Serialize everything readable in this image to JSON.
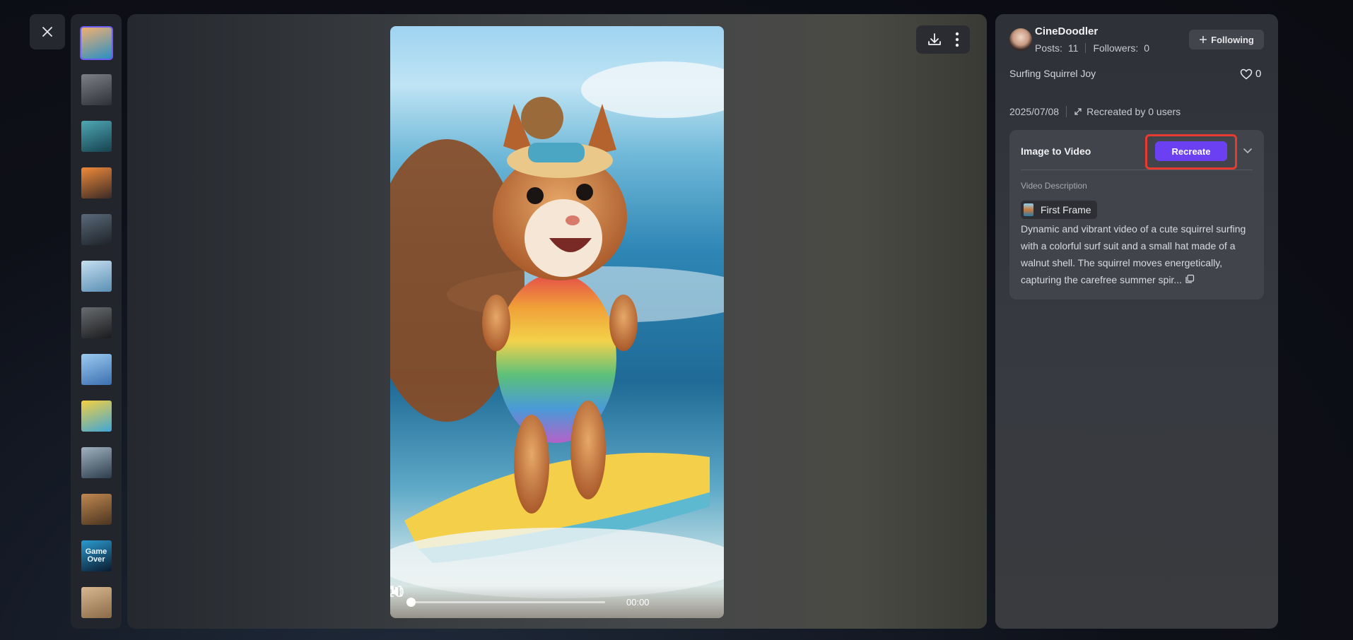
{
  "thumbnails": [
    {
      "label": "squirrel-surfing",
      "colors": [
        "#f0b070",
        "#2b8fc4"
      ]
    },
    {
      "label": "dark-battle",
      "colors": [
        "#7d8186",
        "#2d3035"
      ]
    },
    {
      "label": "underwater-creature",
      "colors": [
        "#4fa7b4",
        "#16424e"
      ]
    },
    {
      "label": "fire-dragon",
      "colors": [
        "#f08a3a",
        "#3a2a26"
      ]
    },
    {
      "label": "dark-figure",
      "colors": [
        "#5a6a7a",
        "#1d2228"
      ]
    },
    {
      "label": "ice-animal",
      "colors": [
        "#c6dff0",
        "#5a8fb4"
      ]
    },
    {
      "label": "armored-figure",
      "colors": [
        "#6a6d70",
        "#1a1b1d"
      ]
    },
    {
      "label": "blue-spirit",
      "colors": [
        "#9ccbf0",
        "#3b6fb0"
      ]
    },
    {
      "label": "yellow-float",
      "colors": [
        "#f5d042",
        "#3fa6d6"
      ]
    },
    {
      "label": "office-cat",
      "colors": [
        "#a0b2c0",
        "#2d3d4c"
      ]
    },
    {
      "label": "warm-scene",
      "colors": [
        "#c08850",
        "#4a3420"
      ]
    },
    {
      "label": "game-over",
      "colors": [
        "#2a9bd0",
        "#0a1a2e"
      ],
      "text": "Game Over"
    },
    {
      "label": "kitten",
      "colors": [
        "#d8b890",
        "#8a6a48"
      ]
    }
  ],
  "player": {
    "time": "00:00",
    "progress": 0.0
  },
  "author": {
    "name": "CineDoodler",
    "posts_label": "Posts:",
    "posts": "11",
    "followers_label": "Followers:",
    "followers": "0",
    "follow_label": "Following"
  },
  "post": {
    "title": "Surfing Squirrel Joy",
    "likes": "0",
    "date": "2025/07/08",
    "recreated": "Recreated by 0 users"
  },
  "card": {
    "title": "Image to Video",
    "recreate_label": "Recreate",
    "desc_label": "Video Description",
    "frame_label": "First Frame",
    "description": "Dynamic and vibrant video of a cute squirrel surfing with a colorful surf suit and a small hat made of a walnut shell. The squirrel moves energetically, capturing the carefree summer spir..."
  },
  "colors": {
    "accent": "#6b3ff2",
    "highlight_outline": "#e63b2e",
    "active_thumb_border": "#6c5cf0"
  }
}
